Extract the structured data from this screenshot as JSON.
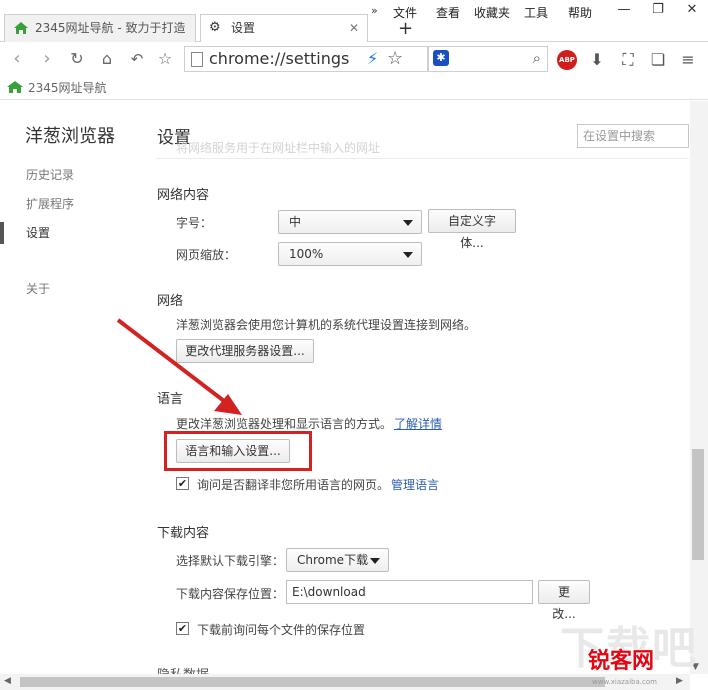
{
  "tabs": [
    {
      "title": "2345网址导航 - 致力于打造",
      "icon": "home-2345-icon"
    },
    {
      "title": "设置",
      "icon": "gear-icon"
    }
  ],
  "menu": [
    "文件",
    "查看",
    "收藏夹",
    "工具",
    "帮助"
  ],
  "chevron": "»",
  "new_tab": "+",
  "omnibox": {
    "url": "chrome://settings"
  },
  "bookmark": {
    "label": "2345网址导航"
  },
  "abp": "ABP",
  "sidebar": {
    "brand": "洋葱浏览器",
    "items": [
      {
        "label": "历史记录"
      },
      {
        "label": "扩展程序"
      },
      {
        "label": "设置"
      },
      {
        "label": "关于"
      }
    ]
  },
  "header": {
    "title": "设置",
    "search_placeholder": "在设置中搜索"
  },
  "ghost_text": "将网络服务用于在网址栏中输入的网址",
  "web_content": {
    "title": "网络内容",
    "font_size_label": "字号：",
    "font_size_value": "中",
    "custom_font_button": "自定义字体...",
    "zoom_label": "网页缩放：",
    "zoom_value": "100%"
  },
  "network": {
    "title": "网络",
    "description": "洋葱浏览器会使用您计算机的系统代理设置连接到网络。",
    "proxy_button": "更改代理服务器设置..."
  },
  "language": {
    "title": "语言",
    "description": "更改洋葱浏览器处理和显示语言的方式。",
    "learn_more": "了解详情",
    "settings_button": "语言和输入设置...",
    "translate_checkbox_label": "询问是否翻译非您所用语言的网页。",
    "manage_languages": "管理语言",
    "translate_checked": true
  },
  "downloads": {
    "title": "下载内容",
    "engine_label": "选择默认下载引擎：",
    "engine_value": "Chrome下载",
    "location_label": "下载内容保存位置：",
    "location_value": "E:\\download",
    "change_button": "更改...",
    "ask_checkbox_label": "下载前询问每个文件的保存位置",
    "ask_checked": true
  },
  "next_section_partial": "隐私数据",
  "watermark": {
    "big": "下载吧",
    "logo": "锐客网",
    "url": "www.xiazaiba.com"
  },
  "colors": {
    "highlight": "#d32222",
    "link": "#2a5db0",
    "abp": "#d21d1d"
  }
}
